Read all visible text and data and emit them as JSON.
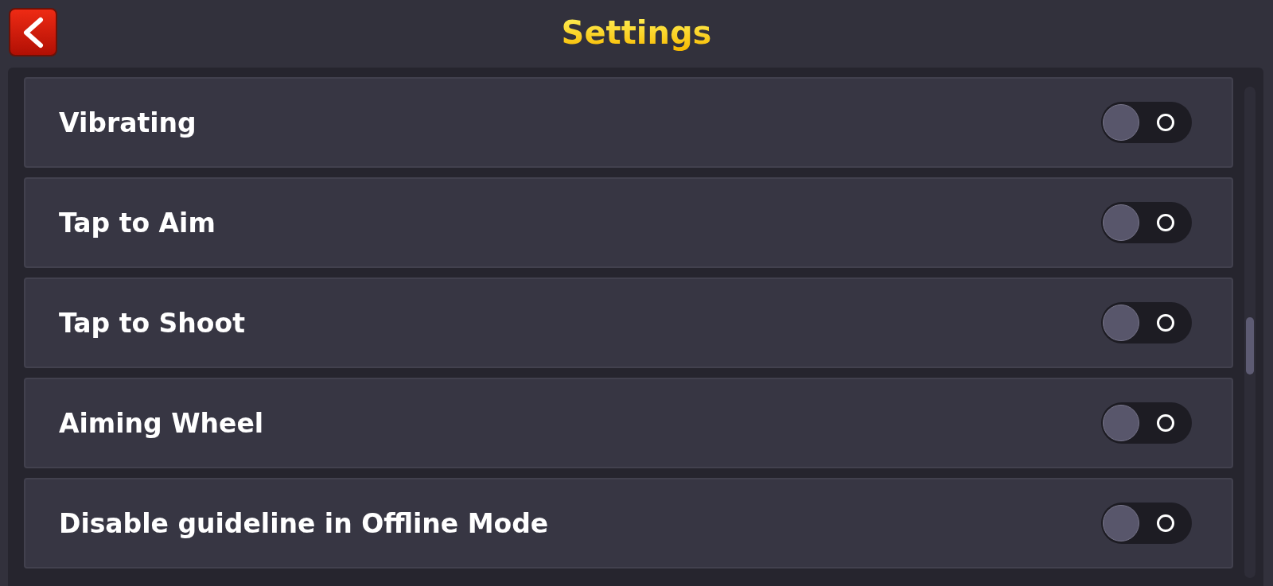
{
  "header": {
    "title": "Settings"
  },
  "settings": [
    {
      "label": "Vibrating",
      "on": false
    },
    {
      "label": "Tap to Aim",
      "on": false
    },
    {
      "label": "Tap to Shoot",
      "on": false
    },
    {
      "label": "Aiming Wheel",
      "on": false
    },
    {
      "label": "Disable guideline in Offline Mode",
      "on": false
    }
  ]
}
